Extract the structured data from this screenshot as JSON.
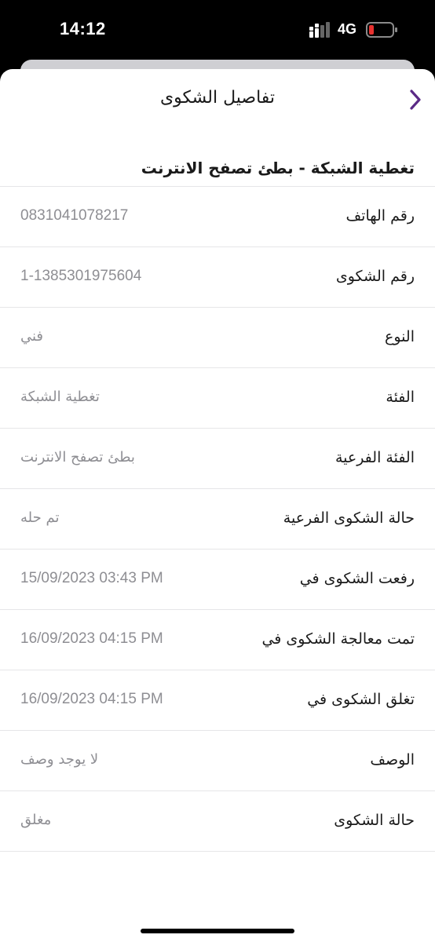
{
  "status_bar": {
    "time": "14:12",
    "network": "4G",
    "battery_color": "#e8312f"
  },
  "header": {
    "title": "تفاصيل الشكوى",
    "back_icon": "chevron-right-icon",
    "accent_color": "#5b2a86"
  },
  "complaint_subject": "تغطية الشبكة - بطئ تصفح الانترنت",
  "details": [
    {
      "label": "رقم الهاتف",
      "value": "0831041078217"
    },
    {
      "label": "رقم الشكوى",
      "value": "1-1385301975604"
    },
    {
      "label": "النوع",
      "value": "فني"
    },
    {
      "label": "الفئة",
      "value": "تغطية الشبكة"
    },
    {
      "label": "الفئة الفرعية",
      "value": "بطئ تصفح الانترنت"
    },
    {
      "label": "حالة الشكوى الفرعية",
      "value": "تم حله"
    },
    {
      "label": "رفعت الشكوى في",
      "value": "15/09/2023 03:43 PM"
    },
    {
      "label": "تمت معالجة الشكوى في",
      "value": "16/09/2023 04:15 PM"
    },
    {
      "label": "تغلق الشكوى في",
      "value": "16/09/2023 04:15 PM"
    },
    {
      "label": "الوصف",
      "value": "لا يوجد وصف"
    },
    {
      "label": "حالة الشكوى",
      "value": "مغلق"
    }
  ]
}
